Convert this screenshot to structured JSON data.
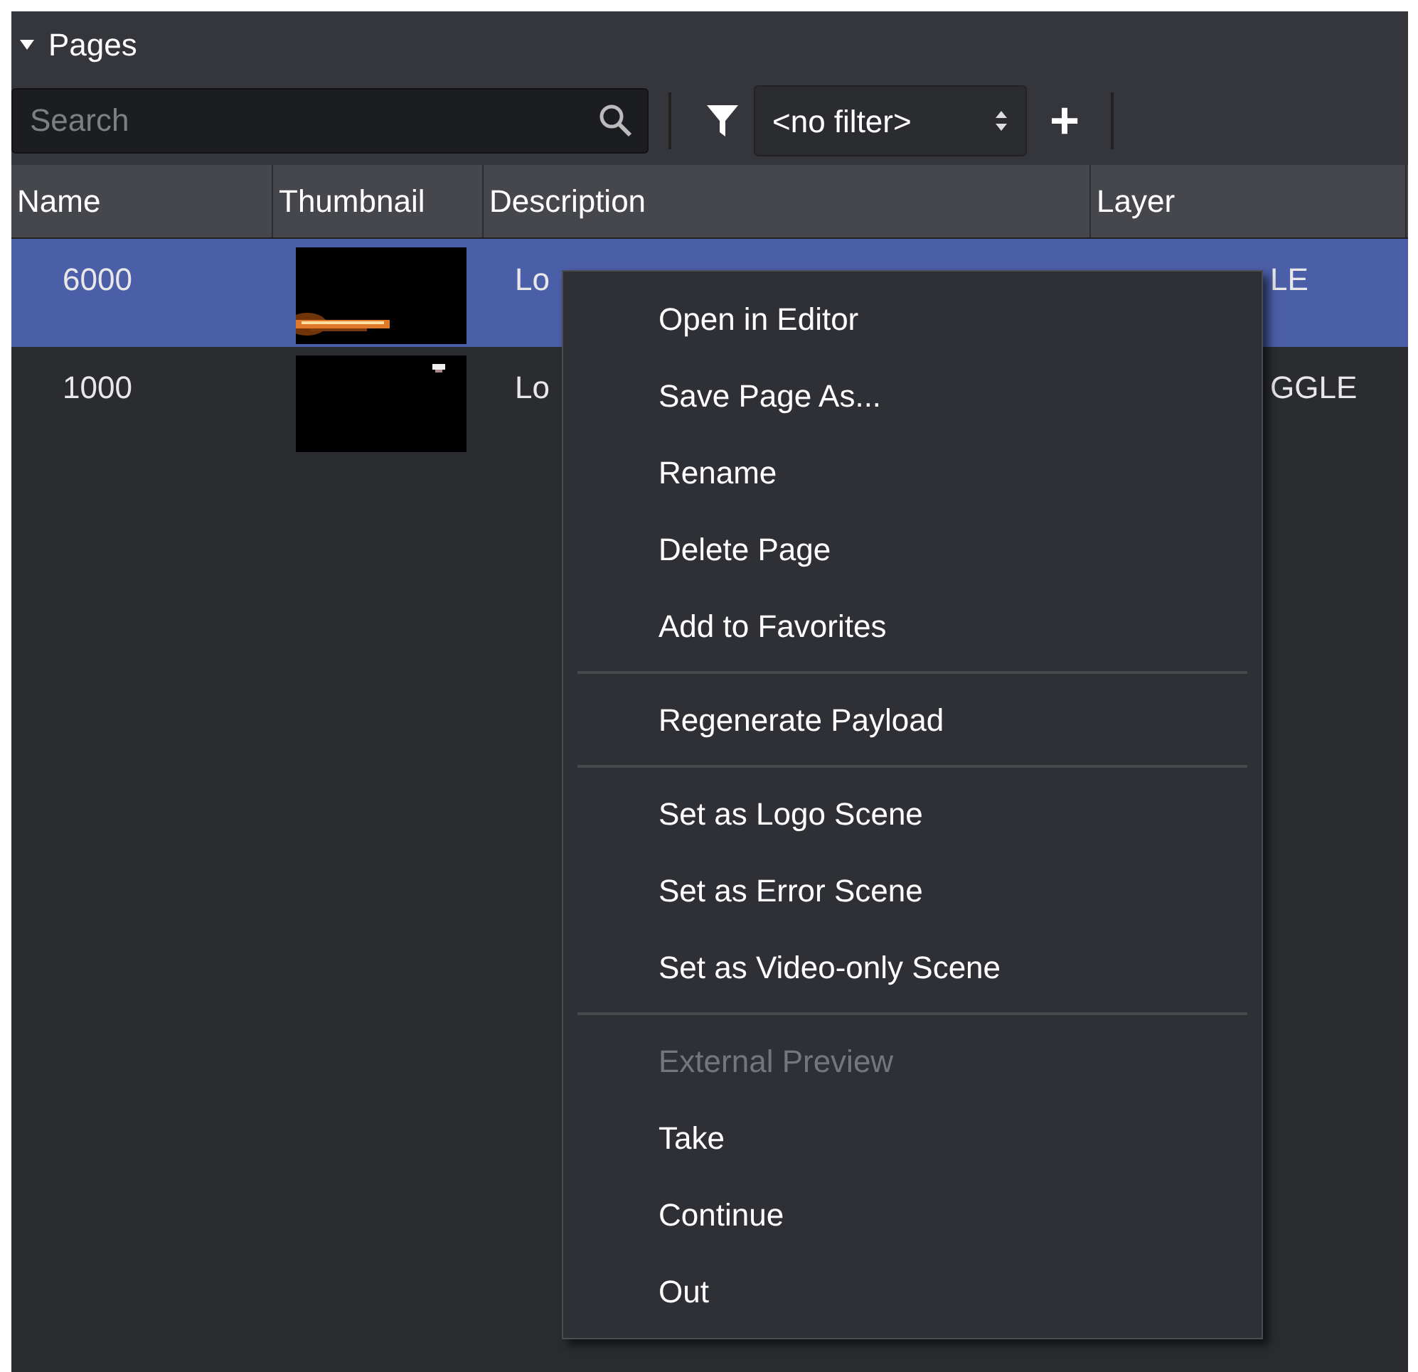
{
  "panel": {
    "title": "Pages",
    "expanded": true
  },
  "toolbar": {
    "search": {
      "placeholder": "Search"
    },
    "filter": {
      "value": "<no filter>"
    },
    "add_label": "+"
  },
  "table": {
    "columns": [
      "Name",
      "Thumbnail",
      "Description",
      "Layer"
    ],
    "rows": [
      {
        "name": "6000",
        "description": "Lo",
        "layer": "LE",
        "selected": true
      },
      {
        "name": "1000",
        "description": "Lo",
        "layer": "GGLE",
        "selected": false
      }
    ]
  },
  "context_menu": {
    "items": [
      {
        "label": "Open in Editor",
        "disabled": false
      },
      {
        "label": "Save Page As...",
        "disabled": false
      },
      {
        "label": "Rename",
        "disabled": false
      },
      {
        "label": "Delete Page",
        "disabled": false
      },
      {
        "label": "Add to Favorites",
        "disabled": false
      },
      {
        "kind": "separator"
      },
      {
        "label": "Regenerate Payload",
        "disabled": false
      },
      {
        "kind": "separator"
      },
      {
        "label": "Set as Logo Scene",
        "disabled": false
      },
      {
        "label": "Set as Error Scene",
        "disabled": false
      },
      {
        "label": "Set as Video-only Scene",
        "disabled": false
      },
      {
        "kind": "separator"
      },
      {
        "label": "External Preview",
        "disabled": true
      },
      {
        "label": "Take",
        "disabled": false
      },
      {
        "label": "Continue",
        "disabled": false
      },
      {
        "label": "Out",
        "disabled": false
      }
    ]
  }
}
